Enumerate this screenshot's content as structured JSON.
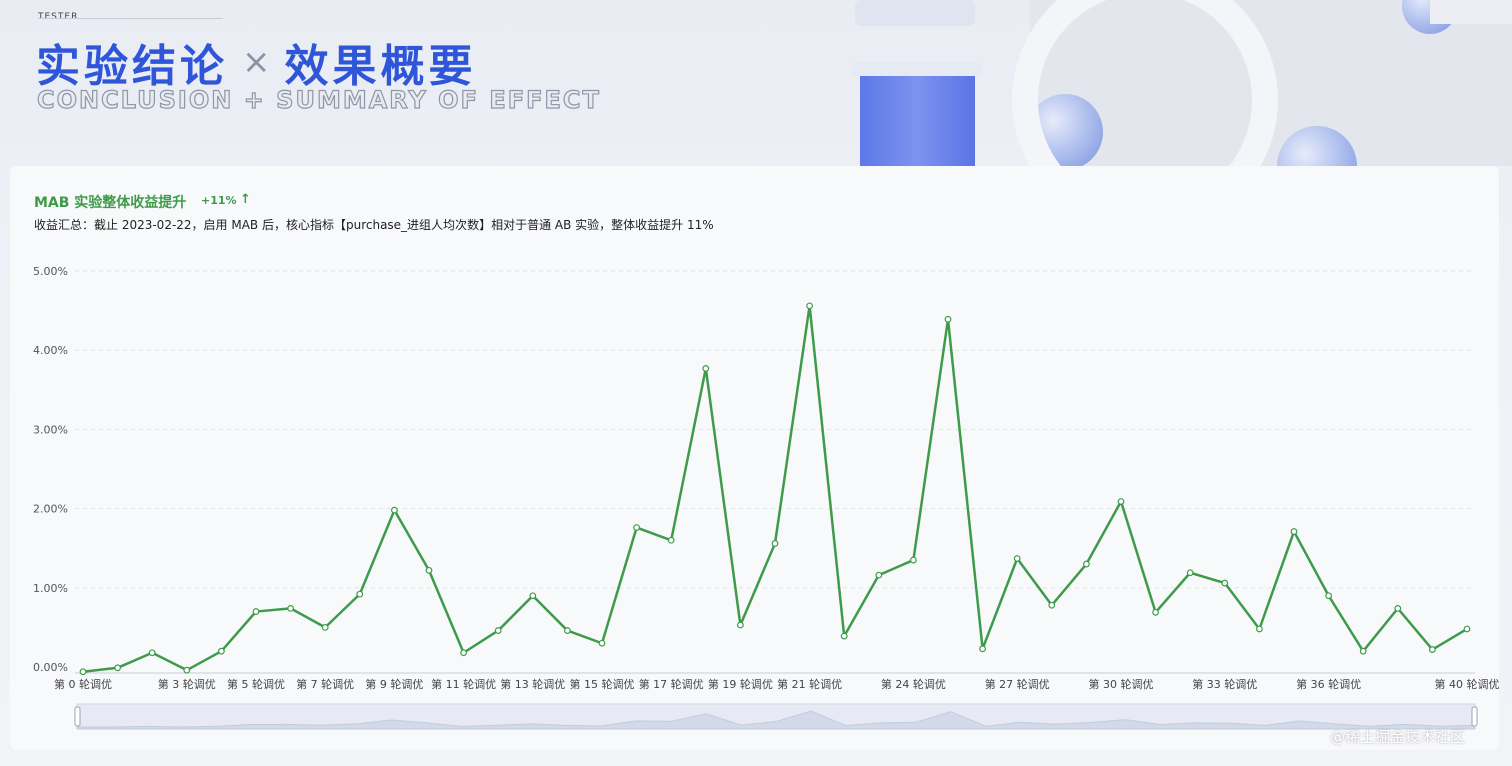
{
  "header": {
    "brand": "TESTER",
    "title_cn_left": "实验结论",
    "title_separator": "×",
    "title_cn_right": "效果概要",
    "title_en": "CONCLUSION + SUMMARY OF EFFECT"
  },
  "card": {
    "title": "MAB 实验整体收益提升",
    "badge": "+11%",
    "badge_arrow": "↑",
    "summary": "收益汇总：截止 2023-02-22，启用 MAB 后，核心指标【purchase_进组人均次数】相对于普通 AB 实验，整体收益提升 11%"
  },
  "watermark": "@稀土掘金技术社区",
  "colors": {
    "accent": "#2f56d9",
    "line": "#3e9b4a",
    "grid": "#dfe3ea"
  },
  "chart_data": {
    "type": "line",
    "title": "MAB 实验整体收益提升",
    "ylim": [
      0,
      5
    ],
    "y_ticks": [
      "0.00%",
      "1.00%",
      "2.00%",
      "3.00%",
      "4.00%",
      "5.00%"
    ],
    "x_tick_labels": [
      {
        "index": 0,
        "label": "第 0 轮调优"
      },
      {
        "index": 3,
        "label": "第 3 轮调优"
      },
      {
        "index": 5,
        "label": "第 5 轮调优"
      },
      {
        "index": 7,
        "label": "第 7 轮调优"
      },
      {
        "index": 9,
        "label": "第 9 轮调优"
      },
      {
        "index": 11,
        "label": "第 11 轮调优"
      },
      {
        "index": 13,
        "label": "第 13 轮调优"
      },
      {
        "index": 15,
        "label": "第 15 轮调优"
      },
      {
        "index": 17,
        "label": "第 17 轮调优"
      },
      {
        "index": 19,
        "label": "第 19 轮调优"
      },
      {
        "index": 21,
        "label": "第 21 轮调优"
      },
      {
        "index": 24,
        "label": "第 24 轮调优"
      },
      {
        "index": 27,
        "label": "第 27 轮调优"
      },
      {
        "index": 30,
        "label": "第 30 轮调优"
      },
      {
        "index": 33,
        "label": "第 33 轮调优"
      },
      {
        "index": 36,
        "label": "第 36 轮调优"
      },
      {
        "index": 40,
        "label": "第 40 轮调优"
      }
    ],
    "series": [
      {
        "values": [
          -0.06,
          -0.01,
          0.18,
          -0.04,
          0.2,
          0.7,
          0.74,
          0.5,
          0.92,
          1.98,
          1.22,
          0.18,
          0.46,
          0.9,
          0.46,
          0.3,
          1.76,
          1.6,
          3.77,
          0.53,
          1.56,
          4.56,
          0.39,
          1.16,
          1.35,
          4.39,
          0.23,
          1.37,
          0.78,
          1.3,
          2.09,
          0.69,
          1.19,
          1.06,
          0.48,
          1.71,
          0.9,
          0.2,
          0.74,
          0.22,
          0.48
        ]
      }
    ],
    "grid": true,
    "legend": "none"
  }
}
